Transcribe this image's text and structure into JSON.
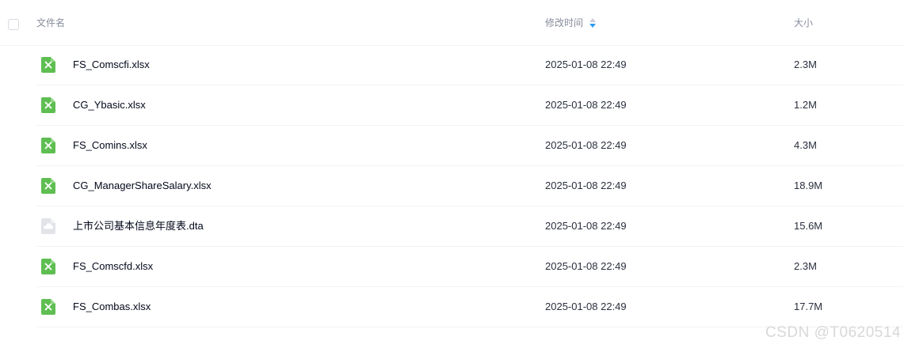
{
  "header": {
    "name_label": "文件名",
    "time_label": "修改时间",
    "size_label": "大小"
  },
  "files": [
    {
      "name": "FS_Comscfi.xlsx",
      "time": "2025-01-08 22:49",
      "size": "2.3M",
      "icon": "excel-file-icon"
    },
    {
      "name": "CG_Ybasic.xlsx",
      "time": "2025-01-08 22:49",
      "size": "1.2M",
      "icon": "excel-file-icon"
    },
    {
      "name": "FS_Comins.xlsx",
      "time": "2025-01-08 22:49",
      "size": "4.3M",
      "icon": "excel-file-icon"
    },
    {
      "name": "CG_ManagerShareSalary.xlsx",
      "time": "2025-01-08 22:49",
      "size": "18.9M",
      "icon": "excel-file-icon"
    },
    {
      "name": "上市公司基本信息年度表.dta",
      "time": "2025-01-08 22:49",
      "size": "15.6M",
      "icon": "generic-file-icon"
    },
    {
      "name": "FS_Comscfd.xlsx",
      "time": "2025-01-08 22:49",
      "size": "2.3M",
      "icon": "excel-file-icon"
    },
    {
      "name": "FS_Combas.xlsx",
      "time": "2025-01-08 22:49",
      "size": "17.7M",
      "icon": "excel-file-icon"
    }
  ],
  "colors": {
    "excel_green": "#5fbe52",
    "generic_gray": "#e2e4e8",
    "sort_active": "#2b9bf0",
    "sort_inactive": "#c9ccd4"
  },
  "watermark": "CSDN @T0620514"
}
